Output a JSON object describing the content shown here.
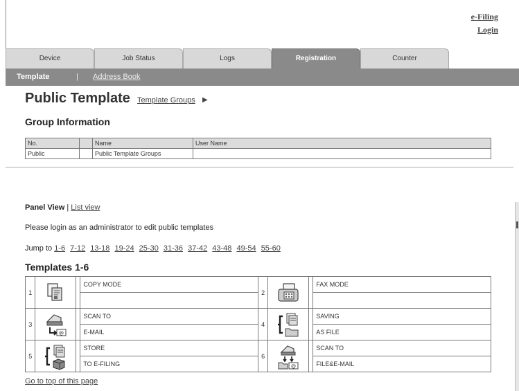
{
  "top_links": {
    "efiling": "e-Filing",
    "login": "Login"
  },
  "tabs": [
    {
      "label": "Device"
    },
    {
      "label": "Job Status"
    },
    {
      "label": "Logs"
    },
    {
      "label": "Registration",
      "active": true
    },
    {
      "label": "Counter"
    }
  ],
  "subnav": {
    "active": "Template",
    "separator": "|",
    "link": "Address Book"
  },
  "page": {
    "title": "Public Template",
    "groups_link": "Template Groups",
    "groups_arrow": "▶"
  },
  "group_info": {
    "title": "Group Information",
    "headers": [
      "No.",
      "",
      "Name",
      "User Name"
    ],
    "row": [
      "Public",
      "",
      "Public Template Groups",
      ""
    ]
  },
  "view": {
    "panel": "Panel View",
    "separator": "|",
    "list": "List view"
  },
  "login_note": "Please login as an administrator to edit public templates",
  "jump": {
    "label": "Jump to",
    "ranges": [
      "1-6",
      "7-12",
      "13-18",
      "19-24",
      "25-30",
      "31-36",
      "37-42",
      "43-48",
      "49-54",
      "55-60"
    ]
  },
  "templates": {
    "title": "Templates 1-6",
    "items": [
      {
        "num": "1",
        "icon": "copy-icon",
        "line1": "COPY MODE",
        "line2": ""
      },
      {
        "num": "2",
        "icon": "fax-icon",
        "line1": "FAX MODE",
        "line2": ""
      },
      {
        "num": "3",
        "icon": "scan-to-email-icon",
        "line1": "SCAN TO",
        "line2": "E-MAIL"
      },
      {
        "num": "4",
        "icon": "save-as-file-icon",
        "line1": "SAVING",
        "line2": "AS FILE"
      },
      {
        "num": "5",
        "icon": "store-to-efiling-icon",
        "line1": "STORE",
        "line2": "TO E-FILING"
      },
      {
        "num": "6",
        "icon": "scan-to-file-email-icon",
        "line1": "SCAN TO",
        "line2": "FILE&E-MAIL"
      }
    ]
  },
  "bottom_link": "Go to top of this page"
}
